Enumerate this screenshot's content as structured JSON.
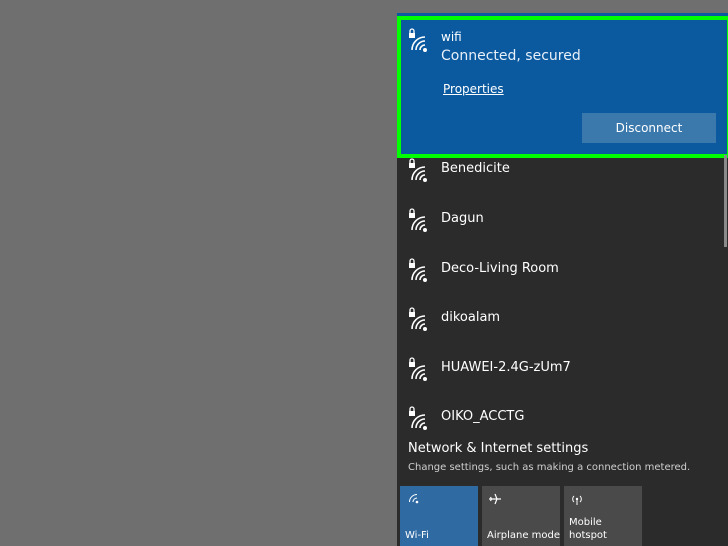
{
  "connected": {
    "ssid": "wifi",
    "status": "Connected, secured",
    "properties_label": "Properties",
    "disconnect_label": "Disconnect"
  },
  "networks": [
    {
      "ssid": "Benedicite",
      "icon": "wifi-secured-icon"
    },
    {
      "ssid": "Dagun",
      "icon": "wifi-secured-icon"
    },
    {
      "ssid": "Deco-Living Room",
      "icon": "wifi-secured-icon"
    },
    {
      "ssid": "dikoalam",
      "icon": "wifi-secured-icon"
    },
    {
      "ssid": "HUAWEI-2.4G-zUm7",
      "icon": "wifi-secured-icon"
    },
    {
      "ssid": "OIKO_ACCTG",
      "icon": "wifi-secured-icon"
    }
  ],
  "settings": {
    "title": "Network & Internet settings",
    "description": "Change settings, such as making a connection metered."
  },
  "quick_actions": [
    {
      "label": "Wi-Fi",
      "icon": "wifi-icon",
      "active": true
    },
    {
      "label": "Airplane mode",
      "icon": "airplane-icon",
      "active": false
    },
    {
      "label": "Mobile hotspot",
      "label_line1": "Mobile",
      "label_line2": "hotspot",
      "icon": "hotspot-icon",
      "active": false
    }
  ],
  "colors": {
    "accent": "#0b5aa0",
    "highlight": "#00ff00",
    "panel": "#2b2b2b",
    "desktop": "#6f6f6f"
  }
}
